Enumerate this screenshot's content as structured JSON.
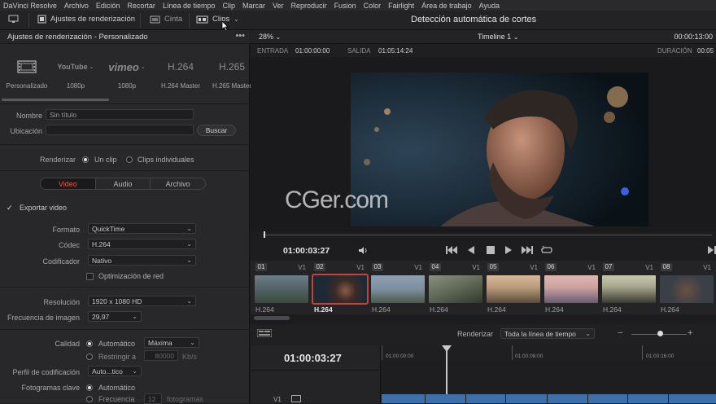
{
  "menu": [
    "DaVinci Resolve",
    "Archivo",
    "Edición",
    "Recortar",
    "Línea de tiempo",
    "Clip",
    "Marcar",
    "Ver",
    "Reproducir",
    "Fusion",
    "Color",
    "Fairlight",
    "Área de trabajo",
    "Ayuda"
  ],
  "toolbar": {
    "render_settings": "Ajustes de renderización",
    "tape": "Cinta",
    "clips": "Clips",
    "title": "Detección automática de cortes"
  },
  "left": {
    "header": "Ajustes de renderización - Personalizado",
    "presets": [
      {
        "logo": "",
        "label": "Personalizado"
      },
      {
        "logo": "YouTube",
        "label": "1080p"
      },
      {
        "logo": "vimeo",
        "label": "1080p"
      },
      {
        "logo": "H.264",
        "label": "H.264 Master"
      },
      {
        "logo": "H.265",
        "label": "H.265 Master"
      }
    ],
    "name_label": "Nombre",
    "name_value": "Sin título",
    "location_label": "Ubicación",
    "browse": "Buscar",
    "render_label": "Renderizar",
    "single_clip": "Un clip",
    "individual_clips": "Clips individuales",
    "tabs": [
      "Video",
      "Audio",
      "Archivo"
    ],
    "export_video": "Exportar video",
    "format_label": "Formato",
    "format": "QuickTime",
    "codec_label": "Códec",
    "codec": "H.264",
    "encoder_label": "Codificador",
    "encoder": "Nativo",
    "network_opt": "Optimización de red",
    "resolution_label": "Resolución",
    "resolution": "1920 x 1080 HD",
    "framerate_label": "Frecuencia de imagen",
    "framerate": "29,97",
    "quality_label": "Calidad",
    "quality_auto": "Automático",
    "quality_value": "Máxima",
    "restrict_label": "Restringir a",
    "restrict_value": "80000",
    "restrict_unit": "Kb/s",
    "profile_label": "Perfil de codificación",
    "profile_value": "Auto...tico",
    "keyframes_label": "Fotogramas clave",
    "keyframes_auto": "Automático",
    "freq_label": "Frecuencia",
    "freq_value": "12",
    "freq_unit": "fotogramas"
  },
  "viewer": {
    "zoom": "28%",
    "timeline": "Timeline 1",
    "timecode_top": "00:00:13:00",
    "in_label": "ENTRADA",
    "in_value": "01:00:00:00",
    "out_label": "SALIDA",
    "out_value": "01:05:14:24",
    "duration_label": "DURACIÓN",
    "duration_value": "00:05",
    "watermark": "CGer.com"
  },
  "transport": {
    "timecode": "01:00:03:27"
  },
  "clips": [
    {
      "num": "01",
      "codec": "H.264",
      "colors": [
        "#5d6b73",
        "#3b4a3a"
      ]
    },
    {
      "num": "02",
      "codec": "H.264",
      "colors": [
        "#1d2a36",
        "#4e3a30"
      ],
      "selected": true
    },
    {
      "num": "03",
      "codec": "H.264",
      "colors": [
        "#7d8fa0",
        "#4a5a4a"
      ]
    },
    {
      "num": "04",
      "codec": "H.264",
      "colors": [
        "#6a7060",
        "#2f3a2a"
      ]
    },
    {
      "num": "05",
      "codec": "H.264",
      "colors": [
        "#b89a7a",
        "#5a4a3a"
      ]
    },
    {
      "num": "06",
      "codec": "H.264",
      "colors": [
        "#caa0a0",
        "#6a5a70"
      ]
    },
    {
      "num": "07",
      "codec": "H.264",
      "colors": [
        "#a8a890",
        "#3a3a30"
      ]
    },
    {
      "num": "08",
      "codec": "H.264",
      "colors": [
        "#3a3f48",
        "#6a5040"
      ]
    }
  ],
  "render_bar": {
    "label": "Renderizar",
    "value": "Toda la línea de tiempo"
  },
  "timeline": {
    "timecode": "01:00:03:27",
    "ruler": [
      "01:00:00:00",
      "01:00:08:00",
      "01:00:16:00"
    ]
  }
}
